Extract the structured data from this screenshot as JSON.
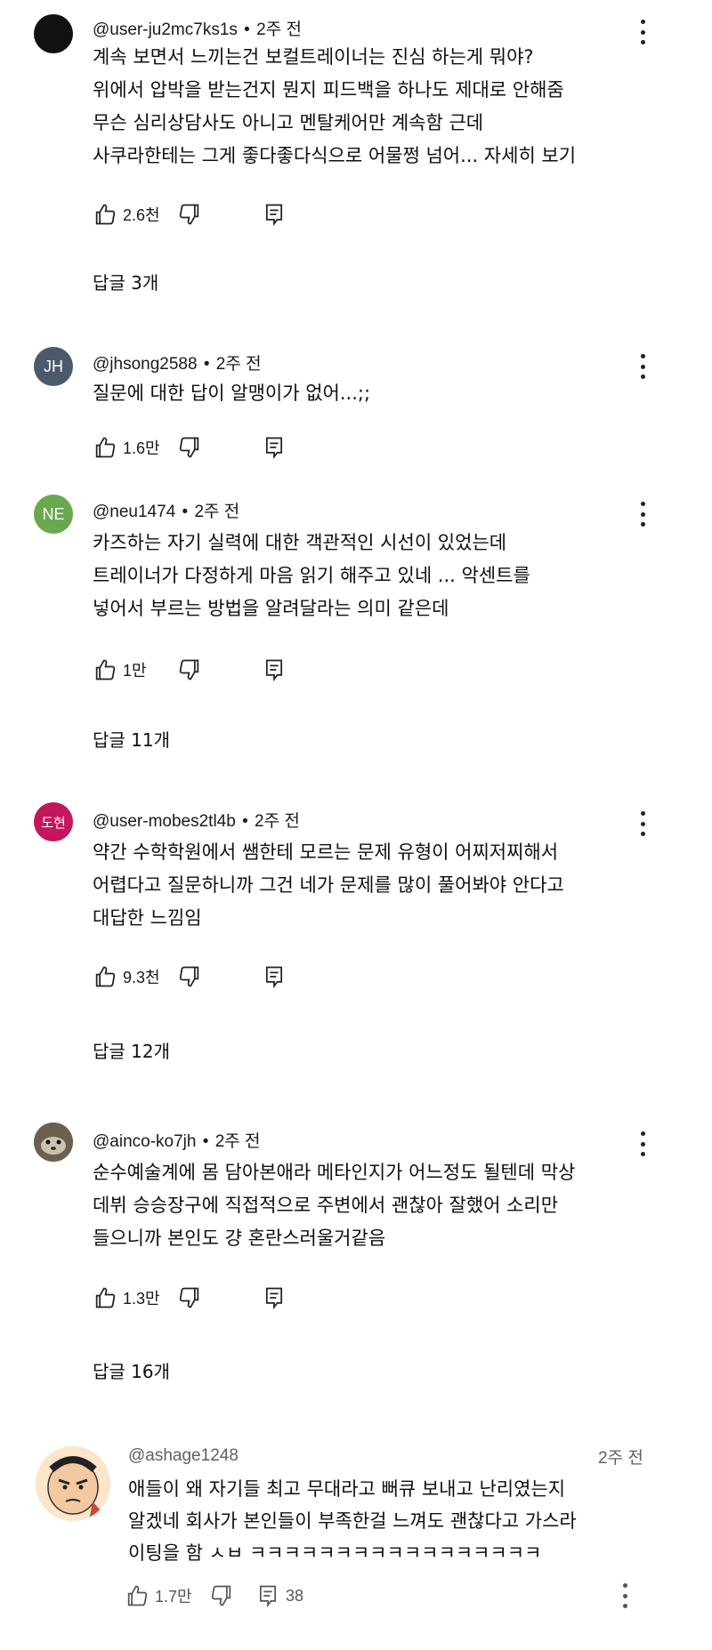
{
  "comments": [
    {
      "author": "@user-ju2mc7ks1s",
      "time": "2주 전",
      "text": "계속 보면서 느끼는건 보컬트레이너는 진심 하는게 뭐야?\n위에서 압박을 받는건지 뭔지 피드백을 하나도 제대로 안해줌\n무슨 심리상담사도 아니고 멘탈케어만 계속함 근데\n사쿠라한테는 그게 좋다좋다식으로 어물쩡 넘어... 자세히 보기",
      "likes": "2.6천",
      "replies": "답글 3개",
      "avatar": {
        "initials": "",
        "color": "#111111"
      }
    },
    {
      "author": "@jhsong2588",
      "time": "2주 전",
      "text": "질문에 대한 답이 알맹이가 없어...;;",
      "likes": "1.6만",
      "replies": "",
      "avatar": {
        "initials": "JH",
        "color": "#4a5a6a"
      }
    },
    {
      "author": "@neu1474",
      "time": "2주 전",
      "text": "카즈하는 자기 실력에 대한 객관적인 시선이 있었는데\n트레이너가 다정하게 마음 읽기 해주고 있네 ... 악센트를\n넣어서 부르는 방법을 알려달라는 의미 같은데",
      "likes": "1만",
      "replies": "답글 11개",
      "avatar": {
        "initials": "NE",
        "color": "#6aa84f"
      }
    },
    {
      "author": "@user-mobes2tl4b",
      "time": "2주 전",
      "text": "약간 수학학원에서 쌤한테 모르는 문제 유형이 어찌저찌해서\n어렵다고 질문하니까 그건 네가 문제를 많이 풀어봐야 안다고\n대답한 느낌임",
      "likes": "9.3천",
      "replies": "답글 12개",
      "avatar": {
        "initials": "도현",
        "color": "#c2185b"
      }
    },
    {
      "author": "@ainco-ko7jh",
      "time": "2주 전",
      "text": "순수예술계에 몸 담아본애라 메타인지가 어느정도 될텐데 막상\n데뷔 승승장구에 직접적으로 주변에서 괜찮아 잘했어 소리만\n들으니까 본인도 걍 혼란스러울거같음",
      "likes": "1.3만",
      "replies": "답글 16개",
      "avatar": {
        "initials": "",
        "color": "#5a5040"
      }
    }
  ],
  "last_comment": {
    "author": "@ashage1248",
    "time": "2주 전",
    "text": "애들이 왜 자기들 최고 무대라고 뻐큐 보내고 난리였는지\n알겠네 회사가 본인들이 부족한걸 느껴도 괜찮다고 가스라\n이팅을 함 ㅅㅂ ㅋㅋㅋㅋㅋㅋㅋㅋㅋㅋㅋㅋㅋㅋㅋㅋㅋ",
    "likes": "1.7만",
    "reply_count": "38"
  }
}
